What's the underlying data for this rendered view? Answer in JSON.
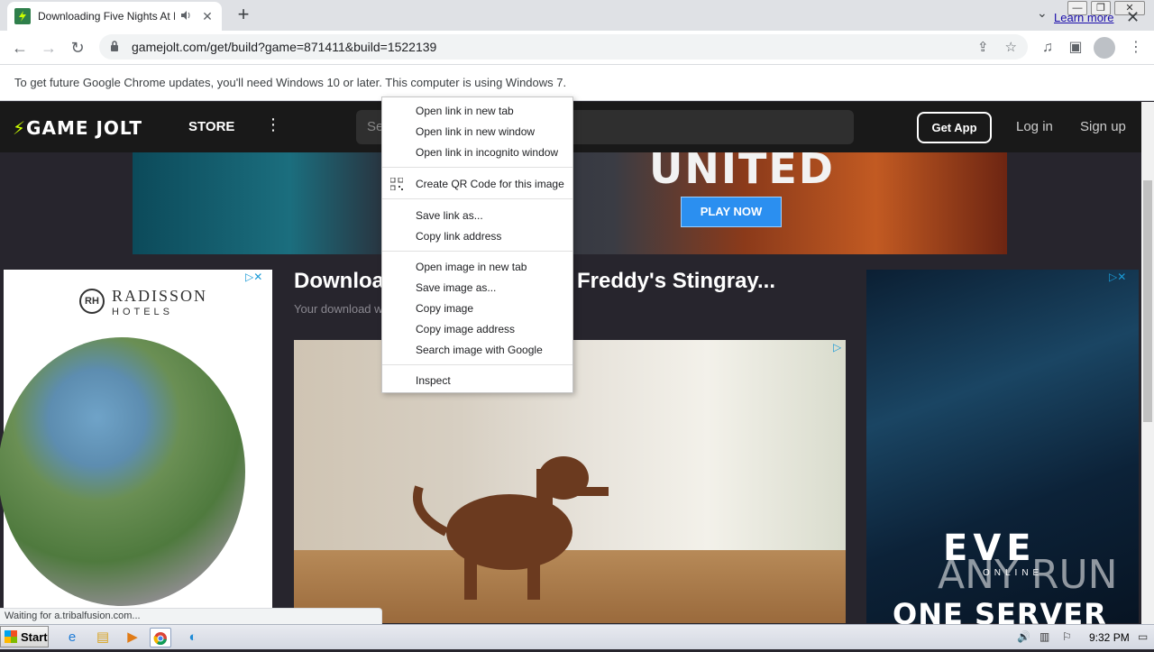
{
  "browser": {
    "tab_title": "Downloading Five Nights At Fre",
    "url": "gamejolt.com/get/build?game=871411&build=1522139",
    "new_tab_symbol": "+",
    "window_controls": [
      "—",
      "❐",
      "✕"
    ]
  },
  "infobar": {
    "message": "To get future Google Chrome updates, you'll need Windows 10 or later. This computer is using Windows 7.",
    "learn_more": "Learn more"
  },
  "gamejolt": {
    "logo_text": "GAME JOLT",
    "store": "STORE",
    "search_placeholder": "Se",
    "get_app": "Get App",
    "log_in": "Log in",
    "sign_up": "Sign up"
  },
  "banner": {
    "headline": "UNITED",
    "cta": "PLAY NOW"
  },
  "left_ad": {
    "brand": "RADISSON",
    "brand_sub": "HOTELS",
    "mark": "RH"
  },
  "page": {
    "title_left": "Downloa",
    "title_right": "Freddy's Stingray...",
    "subtitle": "Your download w"
  },
  "right_ad": {
    "brand": "EVE",
    "brand_sub": "ONLINE",
    "tagline": "ONE SERVER",
    "watermark": "ANY RUN"
  },
  "status_text": "Waiting for a.tribalfusion.com...",
  "context_menu": {
    "group1": [
      "Open link in new tab",
      "Open link in new window",
      "Open link in incognito window"
    ],
    "group2": [
      "Create QR Code for this image"
    ],
    "group3": [
      "Save link as...",
      "Copy link address"
    ],
    "group4": [
      "Open image in new tab",
      "Save image as...",
      "Copy image",
      "Copy image address",
      "Search image with Google"
    ],
    "group5": [
      "Inspect"
    ]
  },
  "taskbar": {
    "start": "Start",
    "clock": "9:32 PM"
  },
  "colors": {
    "gamejolt_bg": "#191919",
    "page_bg": "#27252d",
    "accent_green": "#ccff00",
    "play_now_blue": "#2b8ff0",
    "link_blue": "#1a0dab"
  },
  "icons": [
    "favicon-gamejolt-icon",
    "audio-icon",
    "close-icon",
    "back-icon",
    "forward-icon",
    "reload-icon",
    "lock-icon",
    "share-icon",
    "star-icon",
    "media-icon",
    "sidepanel-icon",
    "profile-icon",
    "menu-icon",
    "qr-code-icon",
    "adchoices-icon"
  ]
}
